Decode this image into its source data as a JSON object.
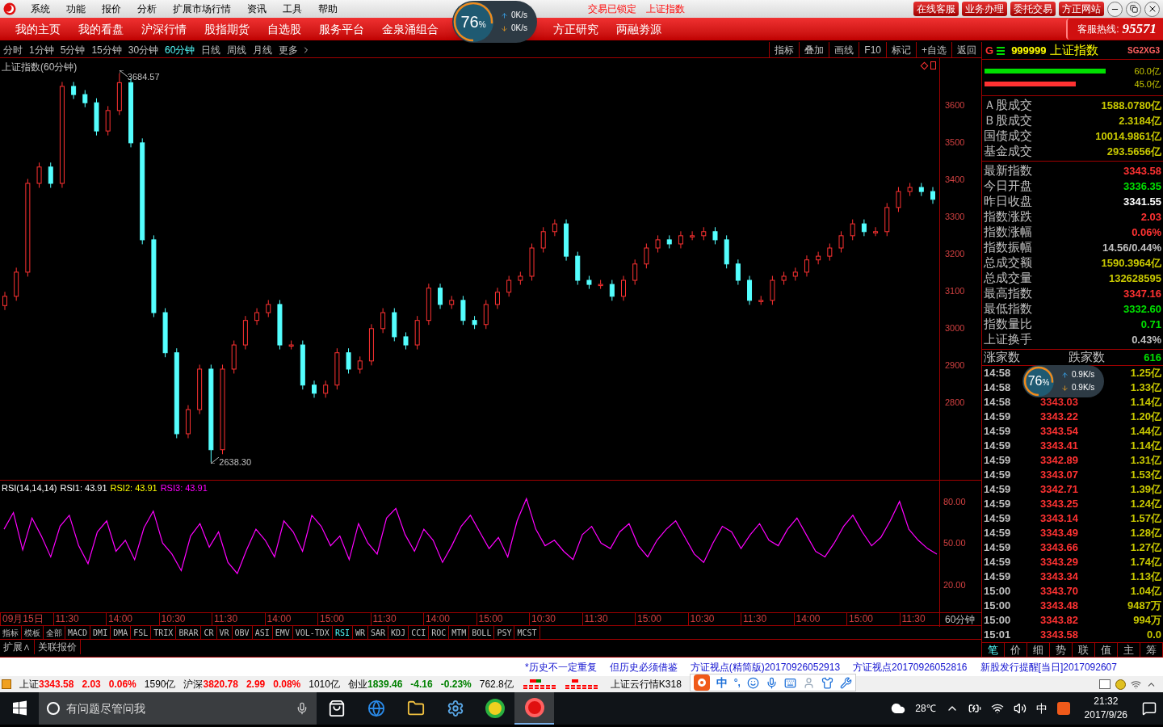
{
  "menu_bar": {
    "items": [
      "系统",
      "功能",
      "报价",
      "分析",
      "扩展市场行情",
      "资讯",
      "工具",
      "帮助"
    ],
    "status_texts": [
      "交易已锁定",
      "上证指数"
    ],
    "buttons": [
      "在线客服",
      "业务办理",
      "委托交易",
      "方正网站"
    ]
  },
  "nav": {
    "items": [
      "我的主页",
      "我的看盘",
      "沪深行情",
      "股指期货",
      "自选股",
      "服务平台",
      "金泉涌组合",
      "方正研究",
      "两融劵源"
    ],
    "hotline_label": "客服热线:",
    "hotline_number": "95571"
  },
  "speed_widgets": [
    {
      "percent": "76",
      "unit": "%",
      "up": "0K/s",
      "down": "0K/s"
    },
    {
      "percent": "76",
      "unit": "%",
      "up": "0.9K/s",
      "down": "0.9K/s"
    }
  ],
  "period_tabs": [
    {
      "label": "分时",
      "selected": false
    },
    {
      "label": "1分钟",
      "selected": false
    },
    {
      "label": "5分钟",
      "selected": false
    },
    {
      "label": "15分钟",
      "selected": false
    },
    {
      "label": "30分钟",
      "selected": false
    },
    {
      "label": "60分钟",
      "selected": true
    },
    {
      "label": "日线",
      "selected": false
    },
    {
      "label": "周线",
      "selected": false
    },
    {
      "label": "月线",
      "selected": false
    },
    {
      "label": "更多",
      "selected": false
    }
  ],
  "chart_tools": [
    "指标",
    "叠加",
    "画线",
    "F10",
    "标记",
    "+自选",
    "返回"
  ],
  "price_chart": {
    "title": "上证指数(60分钟)",
    "high_label": "3684.57",
    "low_label": "2638.30",
    "chart_data": {
      "type": "candlestick",
      "ylim": [
        2591,
        3726
      ],
      "yticks": [
        2800,
        2900,
        3000,
        3100,
        3200,
        3300,
        3400,
        3500,
        3600
      ],
      "ohlc": [
        [
          3060,
          3097,
          3048,
          3085
        ],
        [
          3085,
          3162,
          3073,
          3150
        ],
        [
          3150,
          3401,
          3138,
          3389
        ],
        [
          3389,
          3445,
          3377,
          3433
        ],
        [
          3433,
          3445,
          3377,
          3389
        ],
        [
          3389,
          3662,
          3377,
          3650
        ],
        [
          3650,
          3662,
          3616,
          3628
        ],
        [
          3628,
          3640,
          3594,
          3606
        ],
        [
          3606,
          3618,
          3518,
          3530
        ],
        [
          3530,
          3597,
          3518,
          3585
        ],
        [
          3585,
          3685,
          3573,
          3660
        ],
        [
          3660,
          3672,
          3486,
          3498
        ],
        [
          3498,
          3510,
          3225,
          3237
        ],
        [
          3237,
          3249,
          3029,
          3041
        ],
        [
          3041,
          3053,
          2921,
          2933
        ],
        [
          2933,
          2945,
          2703,
          2715
        ],
        [
          2715,
          2792,
          2703,
          2780
        ],
        [
          2780,
          2901,
          2768,
          2889
        ],
        [
          2889,
          2901,
          2638,
          2672
        ],
        [
          2672,
          2901,
          2660,
          2889
        ],
        [
          2889,
          2966,
          2877,
          2954
        ],
        [
          2954,
          3032,
          2942,
          3020
        ],
        [
          3020,
          3053,
          3008,
          3041
        ],
        [
          3041,
          3075,
          3029,
          3063
        ],
        [
          3063,
          3075,
          2942,
          2954
        ],
        [
          2954,
          2966,
          2942,
          2954
        ],
        [
          2954,
          2966,
          2834,
          2846
        ],
        [
          2846,
          2858,
          2812,
          2824
        ],
        [
          2824,
          2858,
          2812,
          2846
        ],
        [
          2846,
          2945,
          2834,
          2933
        ],
        [
          2933,
          2945,
          2877,
          2889
        ],
        [
          2889,
          2923,
          2877,
          2911
        ],
        [
          2911,
          3010,
          2899,
          2998
        ],
        [
          2998,
          3053,
          2986,
          3041
        ],
        [
          3041,
          3053,
          2964,
          2976
        ],
        [
          2976,
          2988,
          2942,
          2954
        ],
        [
          2954,
          3032,
          2942,
          3020
        ],
        [
          3020,
          3119,
          3008,
          3107
        ],
        [
          3107,
          3119,
          3051,
          3063
        ],
        [
          3063,
          3086,
          3051,
          3074
        ],
        [
          3074,
          3086,
          3008,
          3020
        ],
        [
          3020,
          3032,
          2997,
          3009
        ],
        [
          3009,
          3075,
          2997,
          3063
        ],
        [
          3063,
          3108,
          3051,
          3096
        ],
        [
          3096,
          3140,
          3084,
          3128
        ],
        [
          3128,
          3151,
          3116,
          3139
        ],
        [
          3139,
          3227,
          3127,
          3215
        ],
        [
          3215,
          3271,
          3203,
          3259
        ],
        [
          3259,
          3292,
          3247,
          3280
        ],
        [
          3280,
          3292,
          3181,
          3193
        ],
        [
          3193,
          3205,
          3116,
          3128
        ],
        [
          3128,
          3140,
          3105,
          3117
        ],
        [
          3117,
          3129,
          3105,
          3117
        ],
        [
          3117,
          3129,
          3073,
          3085
        ],
        [
          3085,
          3140,
          3073,
          3128
        ],
        [
          3128,
          3184,
          3116,
          3172
        ],
        [
          3172,
          3227,
          3160,
          3215
        ],
        [
          3215,
          3249,
          3203,
          3237
        ],
        [
          3237,
          3249,
          3214,
          3226
        ],
        [
          3226,
          3260,
          3214,
          3248
        ],
        [
          3248,
          3260,
          3236,
          3248
        ],
        [
          3248,
          3271,
          3236,
          3259
        ],
        [
          3259,
          3271,
          3225,
          3237
        ],
        [
          3237,
          3249,
          3160,
          3172
        ],
        [
          3172,
          3184,
          3116,
          3128
        ],
        [
          3128,
          3140,
          3062,
          3074
        ],
        [
          3074,
          3086,
          3062,
          3074
        ],
        [
          3074,
          3140,
          3062,
          3128
        ],
        [
          3128,
          3151,
          3116,
          3139
        ],
        [
          3139,
          3162,
          3127,
          3150
        ],
        [
          3150,
          3195,
          3138,
          3183
        ],
        [
          3183,
          3205,
          3171,
          3193
        ],
        [
          3193,
          3227,
          3181,
          3215
        ],
        [
          3215,
          3260,
          3203,
          3248
        ],
        [
          3248,
          3292,
          3236,
          3280
        ],
        [
          3280,
          3292,
          3247,
          3259
        ],
        [
          3259,
          3271,
          3247,
          3259
        ],
        [
          3259,
          3336,
          3247,
          3324
        ],
        [
          3324,
          3379,
          3312,
          3367
        ],
        [
          3367,
          3390,
          3355,
          3378
        ],
        [
          3378,
          3390,
          3355,
          3367
        ],
        [
          3367,
          3379,
          3334,
          3346
        ]
      ]
    }
  },
  "rsi_chart": {
    "legend": [
      {
        "text": "RSI(14,14,14)",
        "color": "#ffffff"
      },
      {
        "text": "RSI1: 43.91",
        "color": "#ffffff"
      },
      {
        "text": "RSI2: 43.91",
        "color": "#ffff00"
      },
      {
        "text": "RSI3: 43.91",
        "color": "#ff00ff"
      }
    ],
    "chart_data": {
      "type": "line",
      "ylim": [
        0,
        95
      ],
      "yticks": [
        {
          "value": 20,
          "label": "20.00"
        },
        {
          "value": 50,
          "label": "50.00"
        },
        {
          "value": 80,
          "label": "80.00"
        }
      ],
      "series": [
        {
          "color": "#ff00ff",
          "values": [
            60,
            72,
            45,
            68,
            55,
            40,
            62,
            70,
            48,
            35,
            58,
            66,
            44,
            52,
            38,
            61,
            73,
            50,
            42,
            30,
            55,
            64,
            47,
            58,
            36,
            28,
            45,
            60,
            52,
            40,
            66,
            58,
            44,
            70,
            62,
            48,
            55,
            38,
            64,
            50,
            42,
            68,
            75,
            56,
            44,
            60,
            52,
            36,
            48,
            62,
            70,
            58,
            46,
            54,
            40,
            66,
            82,
            60,
            48,
            52,
            44,
            38,
            56,
            62,
            50,
            46,
            58,
            64,
            48,
            40,
            52,
            60,
            66,
            54,
            42,
            36,
            50,
            62,
            58,
            46,
            56,
            64,
            52,
            48,
            60,
            68,
            56,
            44,
            40,
            50,
            62,
            70,
            58,
            48,
            54,
            66,
            80,
            60,
            52,
            46,
            42
          ]
        }
      ]
    }
  },
  "time_axis": {
    "labels": [
      "09月15日",
      "11:30",
      "14:00",
      "10:30",
      "11:30",
      "14:00",
      "15:00",
      "11:30",
      "14:00",
      "15:00",
      "10:30",
      "11:30",
      "15:00",
      "10:30",
      "11:30",
      "14:00",
      "15:00",
      "11:30"
    ],
    "period": "60分钟"
  },
  "indicator_tabs": [
    {
      "label": "指标",
      "selected": false
    },
    {
      "label": "模板",
      "selected": false
    },
    {
      "label": "全部",
      "selected": false
    },
    {
      "label": "MACD",
      "selected": false
    },
    {
      "label": "DMI",
      "selected": false
    },
    {
      "label": "DMA",
      "selected": false
    },
    {
      "label": "FSL",
      "selected": false
    },
    {
      "label": "TRIX",
      "selected": false
    },
    {
      "label": "BRAR",
      "selected": false
    },
    {
      "label": "CR",
      "selected": false
    },
    {
      "label": "VR",
      "selected": false
    },
    {
      "label": "OBV",
      "selected": false
    },
    {
      "label": "ASI",
      "selected": false
    },
    {
      "label": "EMV",
      "selected": false
    },
    {
      "label": "VOL-TDX",
      "selected": false
    },
    {
      "label": "RSI",
      "selected": true
    },
    {
      "label": "WR",
      "selected": false
    },
    {
      "label": "SAR",
      "selected": false
    },
    {
      "label": "KDJ",
      "selected": false
    },
    {
      "label": "CCI",
      "selected": false
    },
    {
      "label": "ROC",
      "selected": false
    },
    {
      "label": "MTM",
      "selected": false
    },
    {
      "label": "BOLL",
      "selected": false
    },
    {
      "label": "PSY",
      "selected": false
    },
    {
      "label": "MCST",
      "selected": false
    }
  ],
  "extra_tabs": [
    "扩展∧",
    "关联报价"
  ],
  "quote_panel": {
    "header": {
      "mark": "G",
      "code": "999999",
      "name": "上证指数",
      "tag": "SG2XG3"
    },
    "gauges": [
      {
        "color": "#00e000",
        "reading": "60.0亿"
      },
      {
        "color": "#ff3232",
        "reading": "45.0亿"
      }
    ],
    "turnover": [
      {
        "label": "Ａ股成交",
        "value": "1588.0780亿"
      },
      {
        "label": "Ｂ股成交",
        "value": "2.3184亿"
      },
      {
        "label": "国债成交",
        "value": "10014.9861亿"
      },
      {
        "label": "基金成交",
        "value": "293.5656亿"
      }
    ],
    "stats": [
      {
        "label": "最新指数",
        "value": "3343.58",
        "color": "#ff3232"
      },
      {
        "label": "今日开盘",
        "value": "3336.35",
        "color": "#00e000"
      },
      {
        "label": "昨日收盘",
        "value": "3341.55",
        "color": "#ffffff"
      },
      {
        "label": "指数涨跌",
        "value": "2.03",
        "color": "#ff3232"
      },
      {
        "label": "指数涨幅",
        "value": "0.06%",
        "color": "#ff3232"
      },
      {
        "label": "指数振幅",
        "value": "14.56/0.44%",
        "color": "#c0c0c0"
      },
      {
        "label": "总成交额",
        "value": "1590.3964亿",
        "color": "#c8c800"
      },
      {
        "label": "总成交量",
        "value": "132628595",
        "color": "#c8c800"
      },
      {
        "label": "最高指数",
        "value": "3347.16",
        "color": "#ff3232"
      },
      {
        "label": "最低指数",
        "value": "3332.60",
        "color": "#00e000"
      },
      {
        "label": "指数量比",
        "value": "0.71",
        "color": "#00e000"
      },
      {
        "label": "上证换手",
        "value": "0.43%",
        "color": "#c0c0c0"
      }
    ],
    "breadth": {
      "rise_label": "涨家数",
      "fall_label": "跌家数",
      "fall_value": "616"
    },
    "ticks": [
      {
        "time": "14:58",
        "amount": "1.25亿"
      },
      {
        "time": "14:58",
        "amount": "1.33亿"
      },
      {
        "time": "14:58",
        "price": "3343.03",
        "amount": "1.14亿"
      },
      {
        "time": "14:59",
        "price": "3343.22",
        "amount": "1.20亿"
      },
      {
        "time": "14:59",
        "price": "3343.54",
        "amount": "1.44亿"
      },
      {
        "time": "14:59",
        "price": "3343.41",
        "amount": "1.14亿"
      },
      {
        "time": "14:59",
        "price": "3342.89",
        "amount": "1.31亿"
      },
      {
        "time": "14:59",
        "price": "3343.07",
        "amount": "1.53亿"
      },
      {
        "time": "14:59",
        "price": "3342.71",
        "amount": "1.39亿"
      },
      {
        "time": "14:59",
        "price": "3343.25",
        "amount": "1.24亿"
      },
      {
        "time": "14:59",
        "price": "3343.14",
        "amount": "1.57亿"
      },
      {
        "time": "14:59",
        "price": "3343.49",
        "amount": "1.28亿"
      },
      {
        "time": "14:59",
        "price": "3343.66",
        "amount": "1.27亿"
      },
      {
        "time": "14:59",
        "price": "3343.29",
        "amount": "1.74亿"
      },
      {
        "time": "14:59",
        "price": "3343.34",
        "amount": "1.13亿"
      },
      {
        "time": "15:00",
        "price": "3343.70",
        "amount": "1.04亿"
      },
      {
        "time": "15:00",
        "price": "3343.48",
        "amount": "9487万"
      },
      {
        "time": "15:00",
        "price": "3343.82",
        "amount": "994万"
      },
      {
        "time": "15:01",
        "price": "3343.58",
        "amount": "0.0"
      }
    ],
    "tabs": [
      {
        "label": "笔",
        "selected": true
      },
      {
        "label": "价",
        "selected": false
      },
      {
        "label": "细",
        "selected": false
      },
      {
        "label": "势",
        "selected": false
      },
      {
        "label": "联",
        "selected": false
      },
      {
        "label": "值",
        "selected": false
      },
      {
        "label": "主",
        "selected": false
      },
      {
        "label": "筹",
        "selected": false
      }
    ]
  },
  "news_ticker": [
    "*历史不一定重复",
    "但历史必须借鉴",
    "方证视点(精简版)20170926052913",
    "方证视点20170926052816",
    "新股发行提醒[当日]2017092607"
  ],
  "status_bar": {
    "indices": [
      {
        "name": "上证",
        "value": "3343.58",
        "change": "2.03",
        "percent": "0.06%",
        "amount": "1590亿",
        "up": true
      },
      {
        "name": "沪深",
        "value": "3820.78",
        "change": "2.99",
        "percent": "0.08%",
        "amount": "1010亿",
        "up": true
      },
      {
        "name": "创业",
        "value": "1839.46",
        "change": "-4.16",
        "percent": "-0.23%",
        "amount": "762.8亿",
        "up": false
      }
    ],
    "server": "上证云行情K318",
    "ime_mode": "中",
    "ime_punct": "°,"
  },
  "taskbar": {
    "search_placeholder": "有问题尽管问我",
    "weather": "28℃",
    "input_mode": "中",
    "time": "21:32",
    "date": "2017/9/26"
  }
}
